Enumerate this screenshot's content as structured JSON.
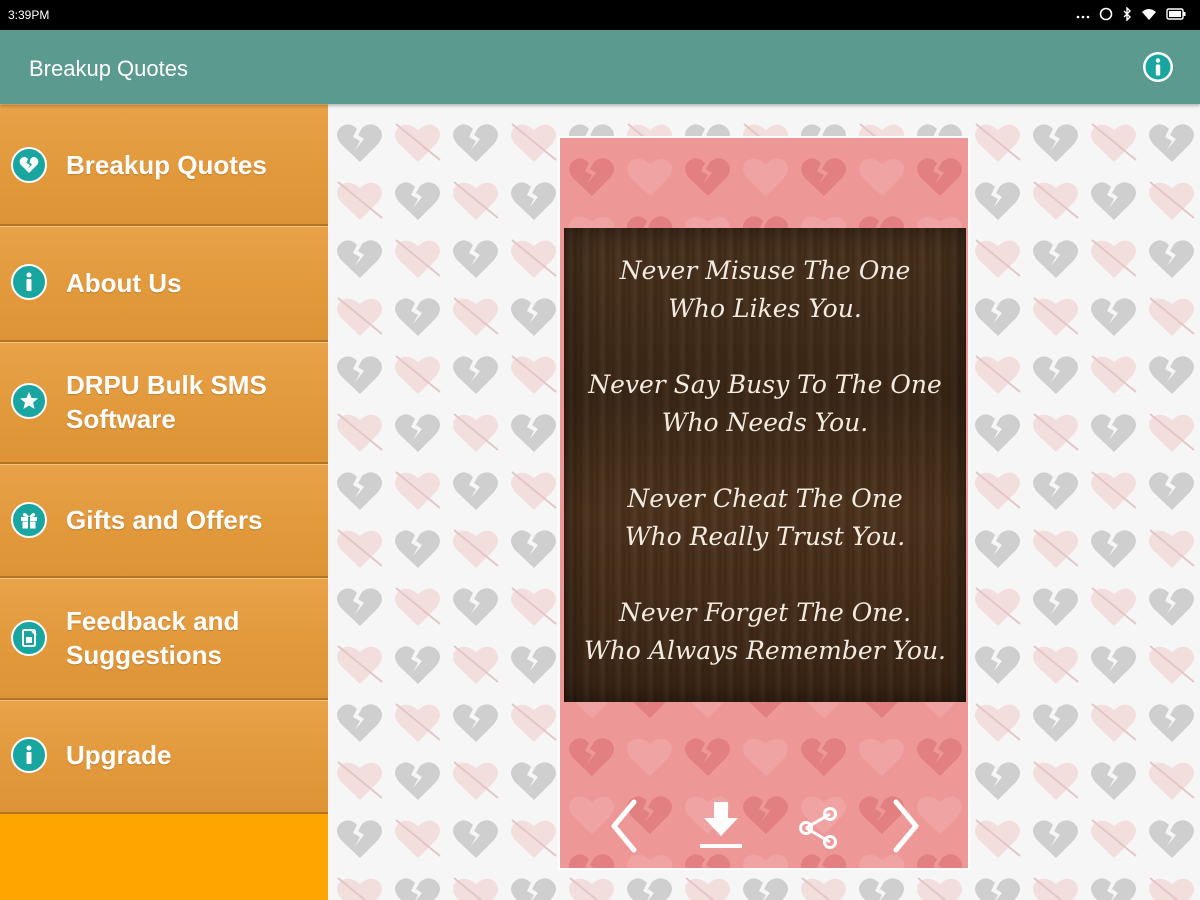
{
  "status_bar": {
    "time": "3:39PM",
    "icons": [
      "dots-icon",
      "alarm-icon",
      "bluetooth-icon",
      "wifi-icon",
      "battery-icon"
    ]
  },
  "action_bar": {
    "title": "Breakup Quotes",
    "info_icon": "info-icon"
  },
  "sidebar": {
    "items": [
      {
        "label_lines": [
          "Breakup Quotes"
        ],
        "icon": "broken-heart-icon"
      },
      {
        "label_lines": [
          "About Us"
        ],
        "icon": "info-icon"
      },
      {
        "label_lines": [
          "DRPU Bulk SMS",
          "Software"
        ],
        "icon": "star-icon"
      },
      {
        "label_lines": [
          "Gifts and Offers"
        ],
        "icon": "gift-icon"
      },
      {
        "label_lines": [
          "Feedback and",
          "Suggestions"
        ],
        "icon": "feedback-icon"
      },
      {
        "label_lines": [
          "Upgrade"
        ],
        "icon": "info-icon"
      }
    ]
  },
  "quote": {
    "lines": [
      "Never Misuse The One",
      "Who Likes You.",
      "Never Say Busy To The One",
      "Who Needs You.",
      "Never Cheat The One",
      "Who Really Trust You.",
      "Never Forget The One.",
      "Who Always Remember You."
    ]
  },
  "controls": [
    "previous-icon",
    "download-icon",
    "share-icon",
    "next-icon"
  ],
  "colors": {
    "action_bar": "#5b9a8e",
    "sidebar_item": "#e29a3d",
    "sidebar_bg": "#ffa500",
    "menu_icon": "#19a6a0",
    "card": "#ee9797"
  }
}
